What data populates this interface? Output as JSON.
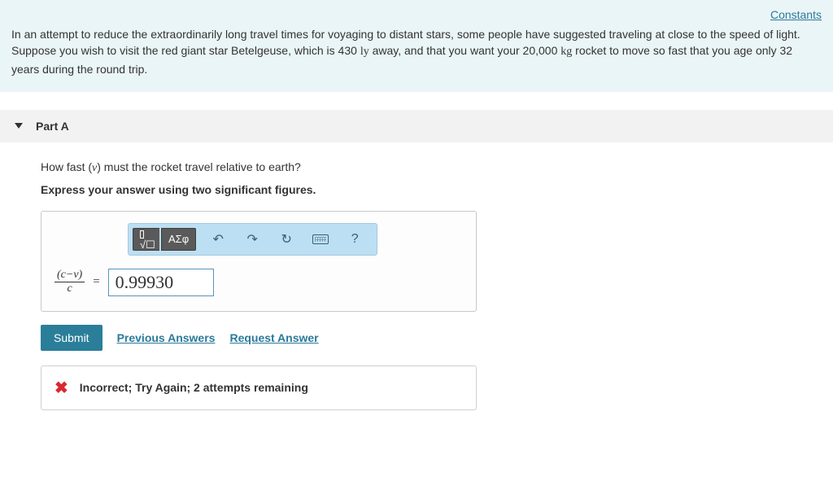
{
  "header": {
    "constants_link": "Constants"
  },
  "intro": {
    "t1": "In an attempt to reduce the extraordinarily long travel times for voyaging to distant stars, some people have suggested traveling at close to the speed of light. Suppose you wish to visit the red giant star Betelgeuse, which is 430 ",
    "u1": "ly",
    "t2": " away, and that you want your 20,000 ",
    "u2": "kg",
    "t3": " rocket to move so fast that you age only 32 years during the round trip."
  },
  "part": {
    "label": "Part A",
    "question_pre": "How fast (",
    "question_var": "v",
    "question_post": ") must the rocket travel relative to earth?",
    "instruction": "Express your answer using two significant figures.",
    "toolbar": {
      "templates_glyph": "√☐",
      "greek": "ΑΣφ",
      "undo": "↶",
      "redo": "↷",
      "reset": "↻",
      "help": "?"
    },
    "fraction": {
      "num": "(c−v)",
      "den": "c"
    },
    "equals": "=",
    "input_value": "0.99930",
    "actions": {
      "submit": "Submit",
      "previous": "Previous Answers",
      "request": "Request Answer"
    },
    "feedback": "Incorrect; Try Again; 2 attempts remaining"
  }
}
